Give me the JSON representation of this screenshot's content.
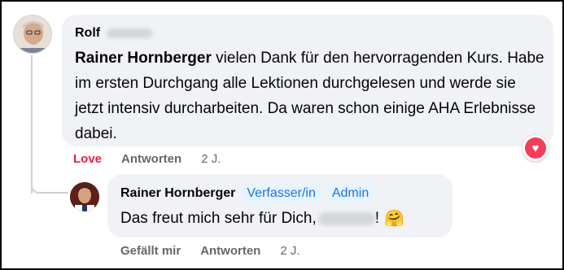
{
  "comment": {
    "author_first": "Rolf",
    "mention": "Rainer Hornberger",
    "text": " vielen Dank für den hervorragenden Kurs. Habe im ersten Durchgang alle Lektionen durchgelesen und werde sie jetzt intensiv durcharbeiten. Da waren schon einige AHA Erlebnisse dabei.",
    "reaction_icon": "heart-icon",
    "reaction_color": "#f33e58",
    "actions": {
      "love": "Love",
      "reply": "Antworten",
      "time": "2 J."
    }
  },
  "reply": {
    "author": "Rainer Hornberger",
    "badges": [
      "Verfasser/in",
      "Admin"
    ],
    "text_prefix": "Das freut mich sehr für Dich,",
    "text_suffix": "!",
    "emoji": "🤗",
    "actions": {
      "like": "Gefällt mir",
      "reply": "Antworten",
      "time": "2 J."
    }
  },
  "colors": {
    "accent": "#1b74e4",
    "love": "#e41e3f",
    "bubble": "#f0f2f5",
    "muted": "#65676b"
  }
}
